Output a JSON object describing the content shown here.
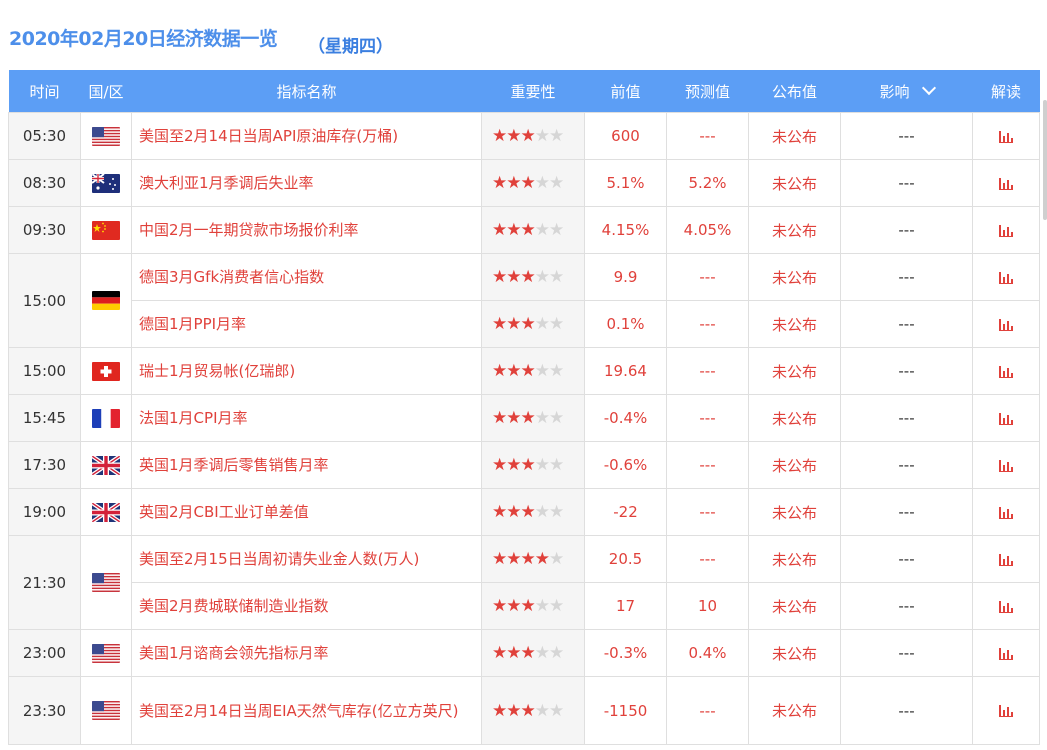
{
  "header": {
    "title": "2020年02月20日经济数据一览",
    "weekday": "（星期四）"
  },
  "columns": {
    "time": "时间",
    "country": "国/区",
    "indicator": "指标名称",
    "importance": "重要性",
    "previous": "前值",
    "forecast": "预测值",
    "actual": "公布值",
    "impact": "影响",
    "interpret": "解读"
  },
  "colors": {
    "accent": "#5c9ef5",
    "title": "#4d8fea",
    "value_red": "#e0413b"
  },
  "groups": [
    {
      "time": "05:30",
      "country": "us",
      "rows": [
        {
          "name": "美国至2月14日当周API原油库存(万桶)",
          "stars": 3,
          "prev": "600",
          "forecast": "---",
          "actual": "未公布",
          "impact": "---"
        }
      ]
    },
    {
      "time": "08:30",
      "country": "au",
      "rows": [
        {
          "name": "澳大利亚1月季调后失业率",
          "stars": 3,
          "prev": "5.1%",
          "forecast": "5.2%",
          "actual": "未公布",
          "impact": "---"
        }
      ]
    },
    {
      "time": "09:30",
      "country": "cn",
      "rows": [
        {
          "name": "中国2月一年期贷款市场报价利率",
          "stars": 3,
          "prev": "4.15%",
          "forecast": "4.05%",
          "actual": "未公布",
          "impact": "---"
        }
      ]
    },
    {
      "time": "15:00",
      "country": "de",
      "rows": [
        {
          "name": "德国3月Gfk消费者信心指数",
          "stars": 3,
          "prev": "9.9",
          "forecast": "---",
          "actual": "未公布",
          "impact": "---"
        },
        {
          "name": "德国1月PPI月率",
          "stars": 3,
          "prev": "0.1%",
          "forecast": "---",
          "actual": "未公布",
          "impact": "---"
        }
      ]
    },
    {
      "time": "15:00",
      "country": "ch",
      "rows": [
        {
          "name": "瑞士1月贸易帐(亿瑞郎)",
          "stars": 3,
          "prev": "19.64",
          "forecast": "---",
          "actual": "未公布",
          "impact": "---"
        }
      ]
    },
    {
      "time": "15:45",
      "country": "fr",
      "rows": [
        {
          "name": "法国1月CPI月率",
          "stars": 3,
          "prev": "-0.4%",
          "forecast": "---",
          "actual": "未公布",
          "impact": "---"
        }
      ]
    },
    {
      "time": "17:30",
      "country": "gb",
      "rows": [
        {
          "name": "英国1月季调后零售销售月率",
          "stars": 3,
          "prev": "-0.6%",
          "forecast": "---",
          "actual": "未公布",
          "impact": "---"
        }
      ]
    },
    {
      "time": "19:00",
      "country": "gb",
      "rows": [
        {
          "name": "英国2月CBI工业订单差值",
          "stars": 3,
          "prev": "-22",
          "forecast": "---",
          "actual": "未公布",
          "impact": "---"
        }
      ]
    },
    {
      "time": "21:30",
      "country": "us",
      "rows": [
        {
          "name": "美国至2月15日当周初请失业金人数(万人)",
          "stars": 4,
          "prev": "20.5",
          "forecast": "---",
          "actual": "未公布",
          "impact": "---"
        },
        {
          "name": "美国2月费城联储制造业指数",
          "stars": 3,
          "prev": "17",
          "forecast": "10",
          "actual": "未公布",
          "impact": "---"
        }
      ]
    },
    {
      "time": "23:00",
      "country": "us",
      "rows": [
        {
          "name": "美国1月谘商会领先指标月率",
          "stars": 3,
          "prev": "-0.3%",
          "forecast": "0.4%",
          "actual": "未公布",
          "impact": "---"
        }
      ]
    },
    {
      "time": "23:30",
      "country": "us",
      "rows": [
        {
          "name": "美国至2月14日当周EIA天然气库存(亿立方英尺)",
          "stars": 3,
          "prev": "-1150",
          "forecast": "---",
          "actual": "未公布",
          "impact": "---"
        }
      ]
    }
  ]
}
